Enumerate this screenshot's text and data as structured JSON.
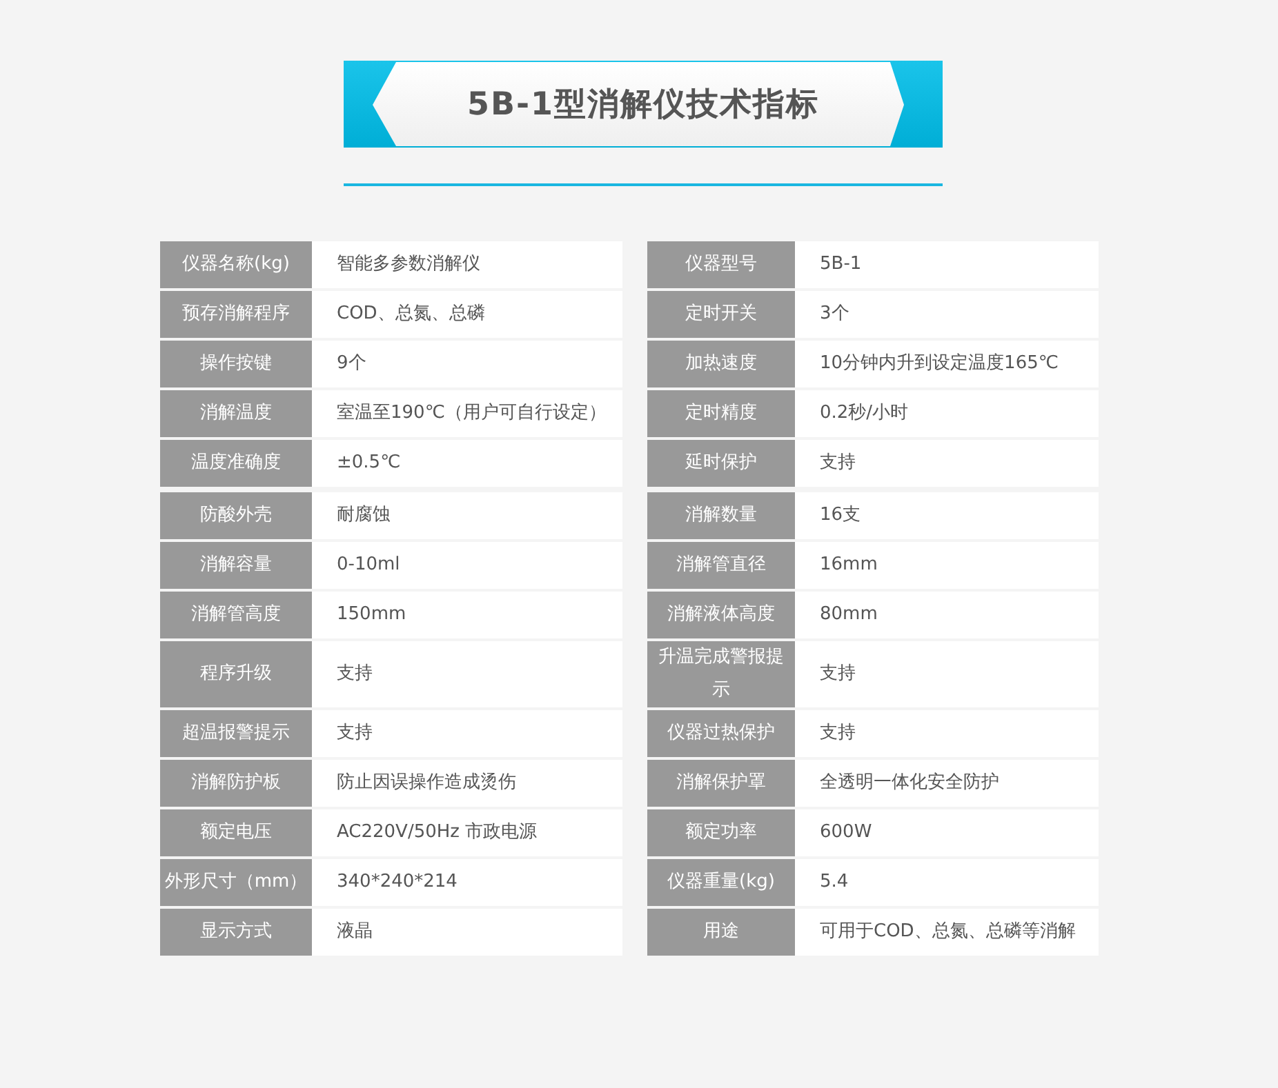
{
  "title": "5B-1型消解仪技术指标",
  "sections": [
    {
      "rows": [
        {
          "left": {
            "label": "仪器名称(kg)",
            "value": "智能多参数消解仪"
          },
          "right": {
            "label": "仪器型号",
            "value": "5B-1"
          }
        },
        {
          "left": {
            "label": "预存消解程序",
            "value": "COD、总氮、总磷"
          },
          "right": {
            "label": "定时开关",
            "value": "3个"
          }
        },
        {
          "left": {
            "label": "操作按键",
            "value": "9个"
          },
          "right": {
            "label": "加热速度",
            "value": "10分钟内升到设定温度165℃"
          }
        },
        {
          "left": {
            "label": "消解温度",
            "value": "室温至190℃（用户可自行设定）"
          },
          "right": {
            "label": "定时精度",
            "value": "0.2秒/小时"
          }
        },
        {
          "left": {
            "label": "温度准确度",
            "value": "±0.5℃"
          },
          "right": {
            "label": "延时保护",
            "value": "支持"
          }
        }
      ]
    },
    {
      "rows": [
        {
          "left": {
            "label": "防酸外壳",
            "value": "耐腐蚀"
          },
          "right": {
            "label": "消解数量",
            "value": "16支"
          }
        },
        {
          "left": {
            "label": "消解容量",
            "value": "0-10ml"
          },
          "right": {
            "label": "消解管直径",
            "value": "16mm"
          }
        },
        {
          "left": {
            "label": "消解管高度",
            "value": "150mm"
          },
          "right": {
            "label": "消解液体高度",
            "value": "80mm"
          }
        },
        {
          "left": {
            "label": "程序升级",
            "value": "支持"
          },
          "right": {
            "label": "升温完成警报提示",
            "value": "支持"
          }
        },
        {
          "left": {
            "label": "超温报警提示",
            "value": "支持"
          },
          "right": {
            "label": "仪器过热保护",
            "value": "支持"
          }
        },
        {
          "left": {
            "label": "消解防护板",
            "value": "防止因误操作造成烫伤"
          },
          "right": {
            "label": "消解保护罩",
            "value": "全透明一体化安全防护"
          }
        },
        {
          "left": {
            "label": "额定电压",
            "value": "AC220V/50Hz 市政电源"
          },
          "right": {
            "label": "额定功率",
            "value": "600W"
          }
        },
        {
          "left": {
            "label": "外形尺寸（mm）",
            "value": "340*240*214"
          },
          "right": {
            "label": "仪器重量(kg)",
            "value": "5.4"
          }
        },
        {
          "left": {
            "label": "显示方式",
            "value": "液晶"
          },
          "right": {
            "label": "用途",
            "value": "可用于COD、总氮、总磷等消解"
          }
        }
      ]
    }
  ]
}
